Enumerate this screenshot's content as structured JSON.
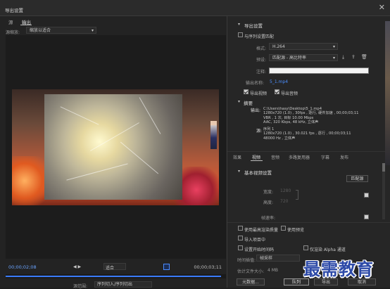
{
  "window": {
    "title": "导出设置",
    "close_glyph": "✕"
  },
  "left_tabs": {
    "source": "源",
    "output": "输出"
  },
  "source_scaling": {
    "label": "源缩放:",
    "value": "缩放以适合"
  },
  "playback": {
    "current_time": "00;00;02;08",
    "end_time": "00;00;03;11",
    "fit_value": "适合",
    "range_label": "源范围:",
    "range_value": "序列切入/序列切出"
  },
  "export_settings": {
    "header": "导出设置",
    "match_sequence": "与序列设置匹配",
    "format_label": "格式:",
    "format_value": "H.264",
    "preset_label": "预设:",
    "preset_value": "匹配源 - 高比特率",
    "comments_label": "注释:",
    "output_name_label": "输出名称:",
    "output_name_value": "5_1.mp4",
    "export_video": "导出视频",
    "export_audio": "导出音频"
  },
  "summary": {
    "header": "摘要",
    "output_label": "输出:",
    "output_lines": [
      "C:\\Users\\hasy\\Desktop\\5_1.mp4",
      "1280x720 (1.0) , 30fps , 逐行, 硬件加速 ,  00;00;03;11",
      "VBR , 1 次, 目标 10.00 Mbps",
      "AAC, 320 Kbps, 48 kHz, 立体声"
    ],
    "source_label": "源:",
    "source_lines": [
      "序列 1",
      "1280x720 (1.0) , 30.021 fps , 逐行 ,  00;00;03;11",
      "48000 Hz , 立体声"
    ]
  },
  "right_tabs": [
    "效果",
    "视频",
    "音频",
    "多路复用器",
    "字幕",
    "发布"
  ],
  "video_settings": {
    "header": "基本视频设置",
    "match_source_button": "匹配源",
    "width_label": "宽度:",
    "width_value": "1280",
    "height_label": "高度:",
    "height_value": "720",
    "frame_rate_label": "帧速率:"
  },
  "bottom_options": {
    "max_render_quality": "使用最高渲染质量",
    "use_previews": "使用预览",
    "import_into_project": "导入项目中",
    "set_start_timecode": "设置开始时间码",
    "render_alpha": "仅渲染 Alpha 通道",
    "time_interp_label": "时间插值:",
    "time_interp_value": "帧采样",
    "file_size_label": "估计文件大小:",
    "file_size_value": "4 MB"
  },
  "buttons": {
    "metadata": "元数据...",
    "queue": "队列",
    "export": "导出",
    "cancel": "取消"
  },
  "watermark": "最需教育",
  "colors": {
    "accent_blue": "#3a7bff",
    "bg_dark": "#1f1f1f",
    "panel": "#262626"
  }
}
